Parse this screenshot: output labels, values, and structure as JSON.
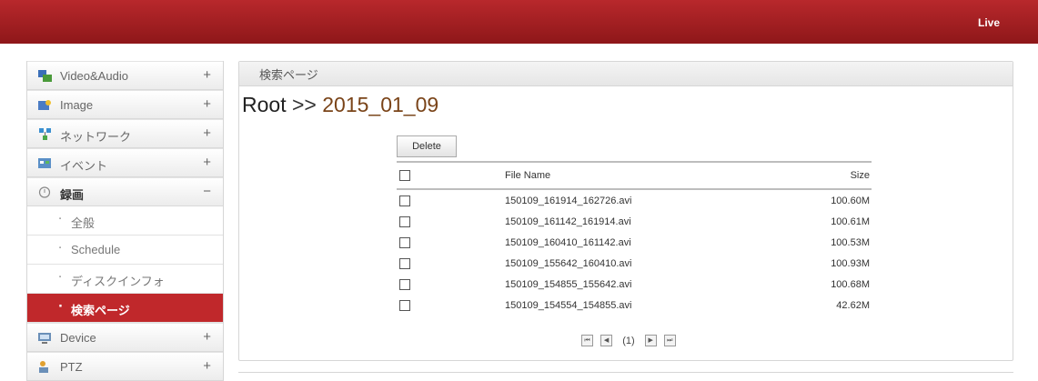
{
  "header": {
    "live_label": "Live",
    "accent": "#a61f22"
  },
  "sidebar": {
    "items": [
      {
        "label": "Video&Audio",
        "toggle": "+",
        "icon": "video-audio-icon"
      },
      {
        "label": "Image",
        "toggle": "+",
        "icon": "image-icon"
      },
      {
        "label": "ネットワーク",
        "toggle": "+",
        "icon": "network-icon"
      },
      {
        "label": "イベント",
        "toggle": "+",
        "icon": "event-icon"
      },
      {
        "label": "録画",
        "toggle": "−",
        "icon": "recording-icon"
      },
      {
        "label": "Device",
        "toggle": "+",
        "icon": "device-icon"
      },
      {
        "label": "PTZ",
        "toggle": "+",
        "icon": "ptz-icon"
      }
    ],
    "sub_items": [
      {
        "label": "全般",
        "bullet": "·"
      },
      {
        "label": "Schedule",
        "bullet": "·"
      },
      {
        "label": "ディスクインフォ",
        "bullet": "·"
      },
      {
        "label": "検索ページ",
        "bullet": "·"
      }
    ]
  },
  "panel": {
    "title": "検索ページ",
    "breadcrumb": {
      "root": "Root",
      "sep": " >> ",
      "folder": "2015_01_09"
    },
    "delete_label": "Delete",
    "columns": {
      "name": "File Name",
      "size": "Size"
    },
    "files": [
      {
        "name": "150109_161914_162726.avi",
        "size": "100.60M"
      },
      {
        "name": "150109_161142_161914.avi",
        "size": "100.61M"
      },
      {
        "name": "150109_160410_161142.avi",
        "size": "100.53M"
      },
      {
        "name": "150109_155642_160410.avi",
        "size": "100.93M"
      },
      {
        "name": "150109_154855_155642.avi",
        "size": "100.68M"
      },
      {
        "name": "150109_154554_154855.avi",
        "size": "42.62M"
      }
    ],
    "pager": {
      "first": "⏮",
      "prev": "◀",
      "page": "(1)",
      "next": "▶",
      "last": "⏭"
    }
  }
}
